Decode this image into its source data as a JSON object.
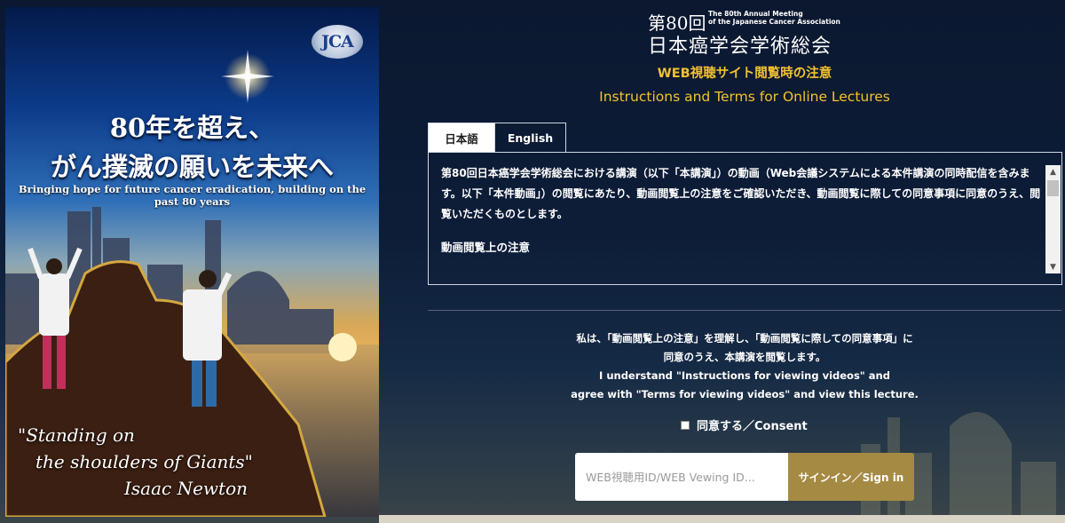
{
  "poster": {
    "logo": "JCA",
    "headline_line1": "80年を超え、",
    "headline_line2": "がん撲滅の願いを未来へ",
    "subtitle": "Bringing hope for future cancer eradication, building on the past 80 years",
    "quote_line1": "\"Standing on",
    "quote_line2": "the shoulders of Giants\"",
    "quote_author": "Isaac Newton"
  },
  "header": {
    "edition": "第80回",
    "meeting_en_line1": "The 80th Annual Meeting",
    "meeting_en_line2": "of the Japanese Cancer Association",
    "meeting_jp": "日本癌学会学術総会"
  },
  "page_title_jp": "WEB視聴サイト閲覧時の注意",
  "page_title_en": "Instructions and Terms for Online Lectures",
  "tabs": [
    {
      "label": "日本語",
      "active": true
    },
    {
      "label": "English",
      "active": false
    }
  ],
  "terms": {
    "paragraph": "第80回日本癌学会学術総会における講演（以下「本講演」）の動画（Web会議システムによる本件講演の同時配信を含みます。以下「本件動画」）の閲覧にあたり、動画閲覧上の注意をご確認いただき、動画閲覧に際しての同意事項に同意のうえ、閲覧いただくものとします。",
    "heading": "動画閲覧上の注意"
  },
  "consent": {
    "line1": "私は、「動画閲覧上の注意」を理解し、「動画閲覧に際しての同意事項」に",
    "line2": "同意のうえ、本講演を閲覧します。",
    "line3": "I understand \"Instructions for viewing videos\" and",
    "line4": "agree with \"Terms for viewing videos\" and view this lecture.",
    "checkbox_label": "同意する／Consent"
  },
  "login": {
    "id_placeholder": "WEB視聴用ID/WEB Vewing ID...",
    "signin_label": "サインイン／Sign in"
  },
  "colors": {
    "accent_gold": "#f2c230",
    "button": "#a58a43",
    "background": "#0d1d38"
  }
}
